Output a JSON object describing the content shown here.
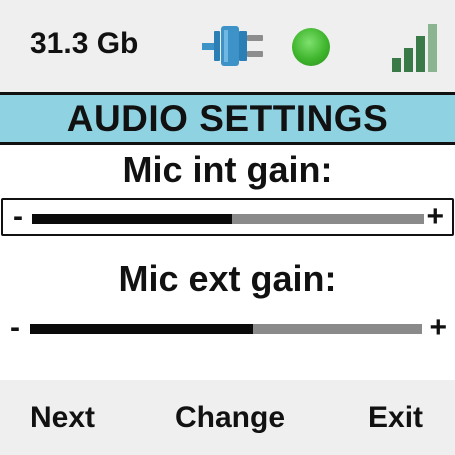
{
  "status_bar": {
    "storage": "31.3 Gb",
    "icons": {
      "usb": "usb-plug-icon",
      "status_light": "green-status-light-icon",
      "signal": "signal-strength-icon"
    },
    "status_light_color": "#3fb52d",
    "signal_bars_active": 3,
    "signal_bars_total": 4
  },
  "header": {
    "title": "AUDIO SETTINGS",
    "background": "#8fd3e3"
  },
  "settings": [
    {
      "label": "Mic int gain:",
      "minus": "-",
      "plus": "+",
      "level": 0.51,
      "selected": true
    },
    {
      "label": "Mic ext gain:",
      "minus": "-",
      "plus": "+",
      "level": 0.57,
      "selected": false
    }
  ],
  "soft_keys": {
    "left": "Next",
    "center": "Change",
    "right": "Exit"
  }
}
